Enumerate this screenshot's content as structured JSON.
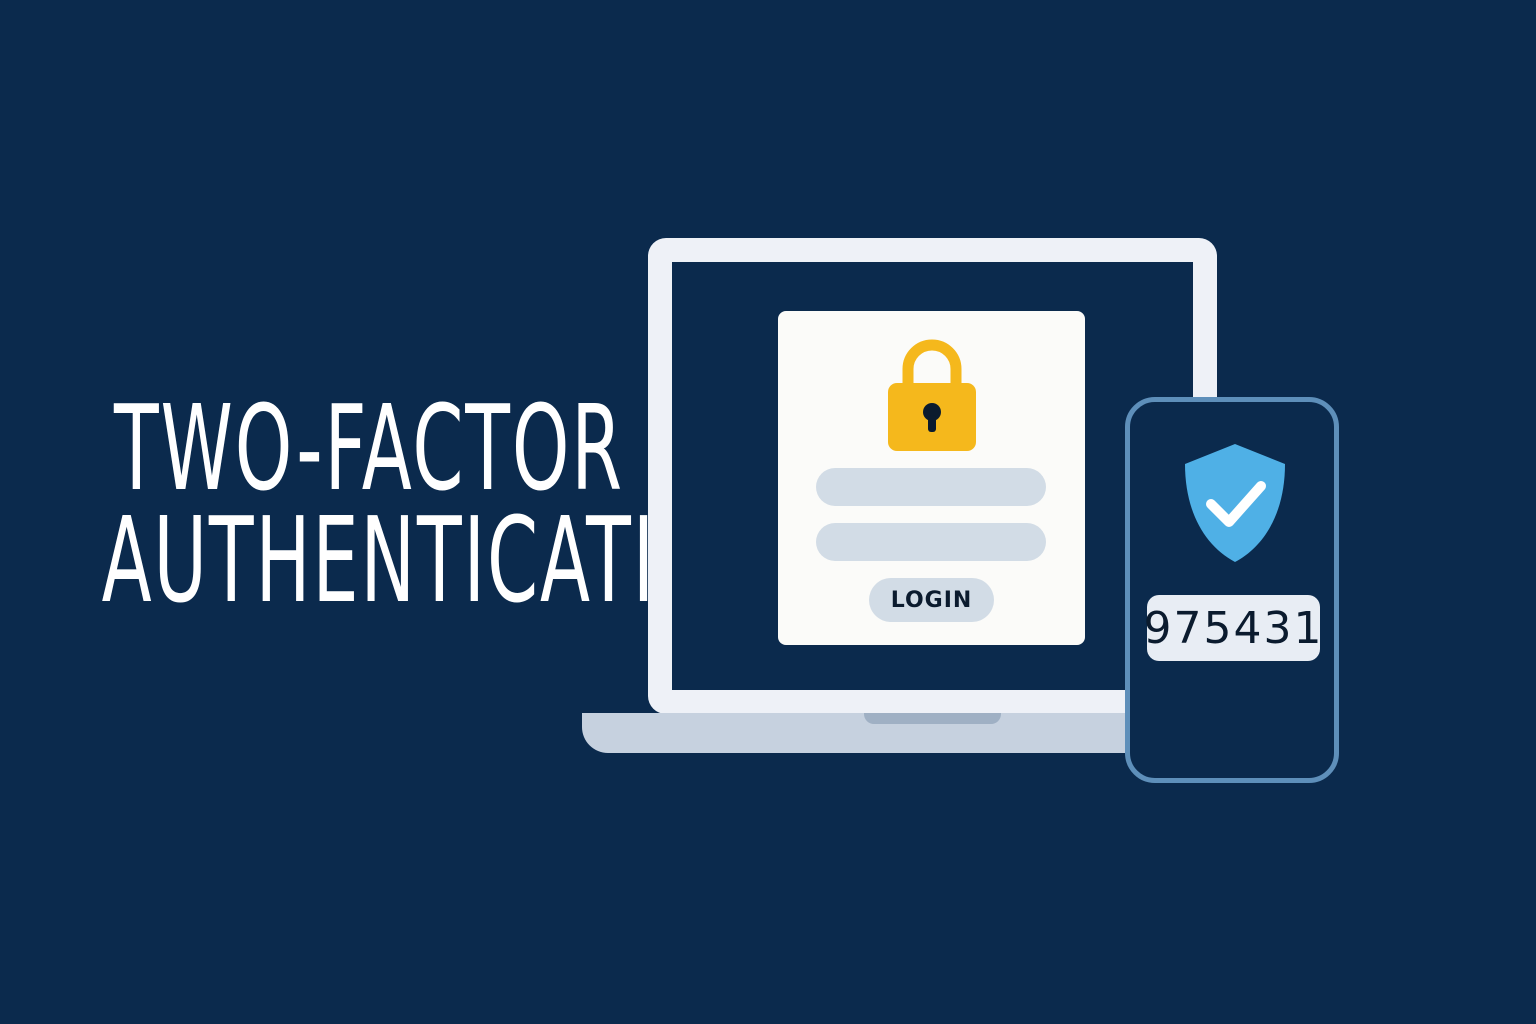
{
  "headline": {
    "line1": "TWO-FACTOR",
    "line2": "AUTHENTICATION"
  },
  "login_card": {
    "icon": "padlock-icon",
    "login_button_label": "LOGIN"
  },
  "phone": {
    "icon": "shield-check-icon",
    "verification_code": "975431"
  },
  "colors": {
    "background": "#0b2a4d",
    "padlock": "#f5b81c",
    "shield": "#4fb0e6",
    "phone_frame": "#5e8fba"
  }
}
